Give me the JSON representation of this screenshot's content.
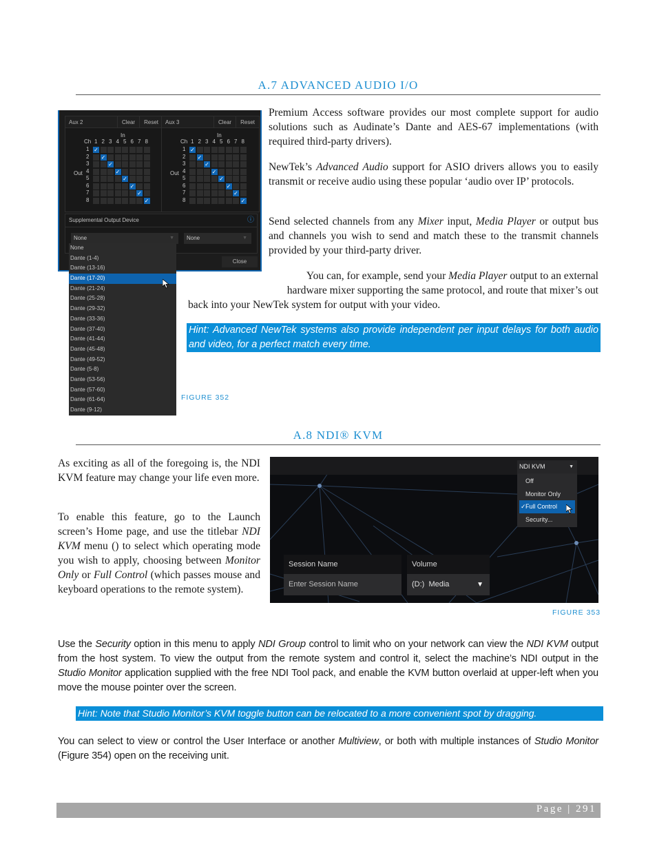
{
  "section_a7": {
    "heading": "A.7 ADVANCED AUDIO I/O",
    "paragraphs": [
      "Premium Access software provides our most complete support for audio solutions such as Audinate’s Dante and AES-67 implementations (with required third-party drivers).",
      "Send selected channels from any Mixer input, Media Player or output bus and channels you wish to send and match these to the transmit channels provided by your third-party driver."
    ],
    "p2": {
      "a": "NewTek’s ",
      "i": "Advanced Audio",
      "b": " support for ASIO drivers allows you to easily transmit or receive audio using these popular ‘audio over IP’ protocols."
    },
    "p3": {
      "a": "Send selected channels from any ",
      "i1": "Mixer",
      "b": " input, ",
      "i2": "Media Player",
      "c": " or output bus and channels you wish to send and match these to the transmit channels provided by your third-party driver."
    },
    "p4_line1": {
      "a": "You can, for example, send your ",
      "i": "Media Player",
      "b": " output to an external"
    },
    "p4_line2": "hardware mixer supporting the same protocol, and route that mixer’s out",
    "p4_line3": "back into your NewTek system for output with your video.",
    "hint": "Hint: Advanced NewTek systems also provide independent per input delays for both audio and video, for a perfect match every time.",
    "figure_caption": "FIGURE 352"
  },
  "figure352": {
    "aux_panels": [
      {
        "title": "Aux 2",
        "clear": "Clear",
        "reset": "Reset"
      },
      {
        "title": "Aux 3",
        "clear": "Clear",
        "reset": "Reset"
      }
    ],
    "in_label": "In",
    "ch_label": "Ch",
    "out_label": "Out",
    "channels": [
      "1",
      "2",
      "3",
      "4",
      "5",
      "6",
      "7",
      "8"
    ],
    "checked": [
      [
        1,
        1
      ],
      [
        2,
        2
      ],
      [
        3,
        3
      ],
      [
        4,
        4
      ],
      [
        5,
        5
      ],
      [
        6,
        6
      ],
      [
        7,
        7
      ],
      [
        8,
        8
      ]
    ],
    "check_glyph": "✓",
    "supplemental_label": "Supplemental Output Device",
    "info_icon": "ⓘ",
    "dropdown1_value": "None",
    "dropdown2_value": "None",
    "close_label": "Close",
    "dropdown_options": [
      "None",
      "Dante (1-4)",
      "Dante (13-16)",
      "Dante (17-20)",
      "Dante (21-24)",
      "Dante (25-28)",
      "Dante (29-32)",
      "Dante (33-36)",
      "Dante (37-40)",
      "Dante (41-44)",
      "Dante (45-48)",
      "Dante (49-52)",
      "Dante (5-8)",
      "Dante (53-56)",
      "Dante (57-60)",
      "Dante (61-64)",
      "Dante (9-12)"
    ],
    "selected_option": "Dante (17-20)"
  },
  "section_a8": {
    "heading": "A.8 NDI® KVM",
    "p1": "As exciting as all of the foregoing is, the NDI KVM feature may change your life even more.",
    "p2": {
      "a": "To enable this feature, go to the Launch screen’s Home page, and use the titlebar ",
      "i1": "NDI KVM",
      "b": " menu () to select which operating mode you wish to apply, choosing between ",
      "i2": "Monitor Only",
      "c": " or ",
      "i3": "Full Control",
      "d": " (which passes mouse and keyboard operations to the remote system)."
    },
    "p3": {
      "a": "Use the ",
      "i1": "Security",
      "b": " option in this menu to apply ",
      "i2": "NDI Group",
      "c": " control to limit who on your network can view the ",
      "i3": "NDI KVM",
      "d": " output from the host system.  To view the output from the remote system and control it, select the machine’s NDI output in the ",
      "i4": "Studio Monitor",
      "e": " application supplied  with the free NDI Tool pack, and enable the KVM button overlaid at upper-left when you move the mouse pointer over the screen."
    },
    "hint": "Hint: Note that Studio Monitor’s KVM toggle button can be relocated to a more convenient spot by dragging.",
    "p4": {
      "a": "You can select to view or control the User Interface or another ",
      "i1": "Multiview",
      "b": ", or both with multiple instances of ",
      "i2": "Studio Monitor",
      "c": " (Figure 354) open on the receiving unit."
    },
    "figure_caption": "FIGURE 353"
  },
  "figure353": {
    "kvm_menu_label": "NDI KVM",
    "kvm_options": [
      "Off",
      "Monitor Only",
      "Full Control",
      "Security..."
    ],
    "kvm_selected": "Full Control",
    "check_glyph": "✓",
    "session_name_label": "Session Name",
    "session_name_placeholder": "Enter Session Name",
    "volume_label": "Volume",
    "volume_value": "(D:)  Media"
  },
  "footer": {
    "page_label": "Page | 291"
  },
  "colors": {
    "accent": "#1e8fd1",
    "hint_bg": "#0b8fd8",
    "selection": "#0e63ae"
  }
}
